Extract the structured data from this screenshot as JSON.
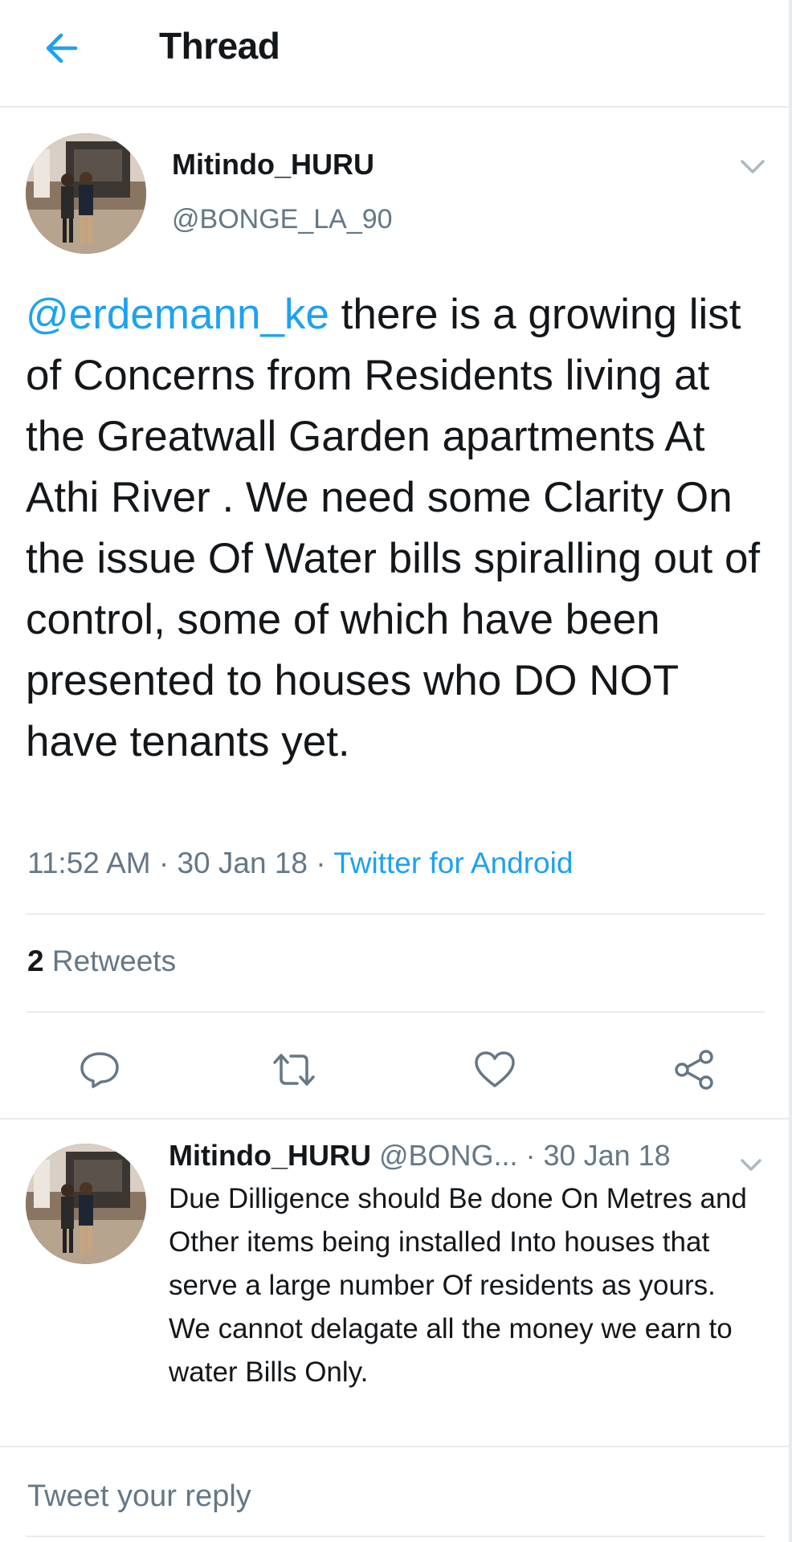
{
  "header": {
    "title": "Thread"
  },
  "tweet": {
    "author_name": "Mitindo_HURU",
    "author_handle": "@BONGE_LA_90",
    "mention": "@erdemann_ke",
    "text": " there is a growing list of Concerns from Residents living at the Greatwall Garden apartments At Athi River . We need some Clarity On the issue Of Water bills spiralling out of control, some of which have been presented to houses who DO NOT have tenants yet.",
    "time": "11:52 AM",
    "sep1": " · ",
    "date": "30 Jan 18",
    "sep2": " · ",
    "source": "Twitter for Android",
    "retweet_count": "2",
    "retweet_label": " Retweets"
  },
  "actions": [
    "reply-icon",
    "retweet-icon",
    "like-icon",
    "share-icon"
  ],
  "reply": {
    "author_name": "Mitindo_HURU",
    "author_handle": " @BONG...",
    "date": "  · 30 Jan 18",
    "line1": "Due Dilligence should Be done On Metres and Other items being installed Into houses that serve a large number Of residents as yours.",
    "line2": "We cannot delagate all the money we earn to water Bills Only."
  },
  "composer": {
    "placeholder": "Tweet your reply"
  },
  "colors": {
    "accent": "#1da1f2",
    "secondary_text": "#657786",
    "divider": "#e6ecf0"
  }
}
